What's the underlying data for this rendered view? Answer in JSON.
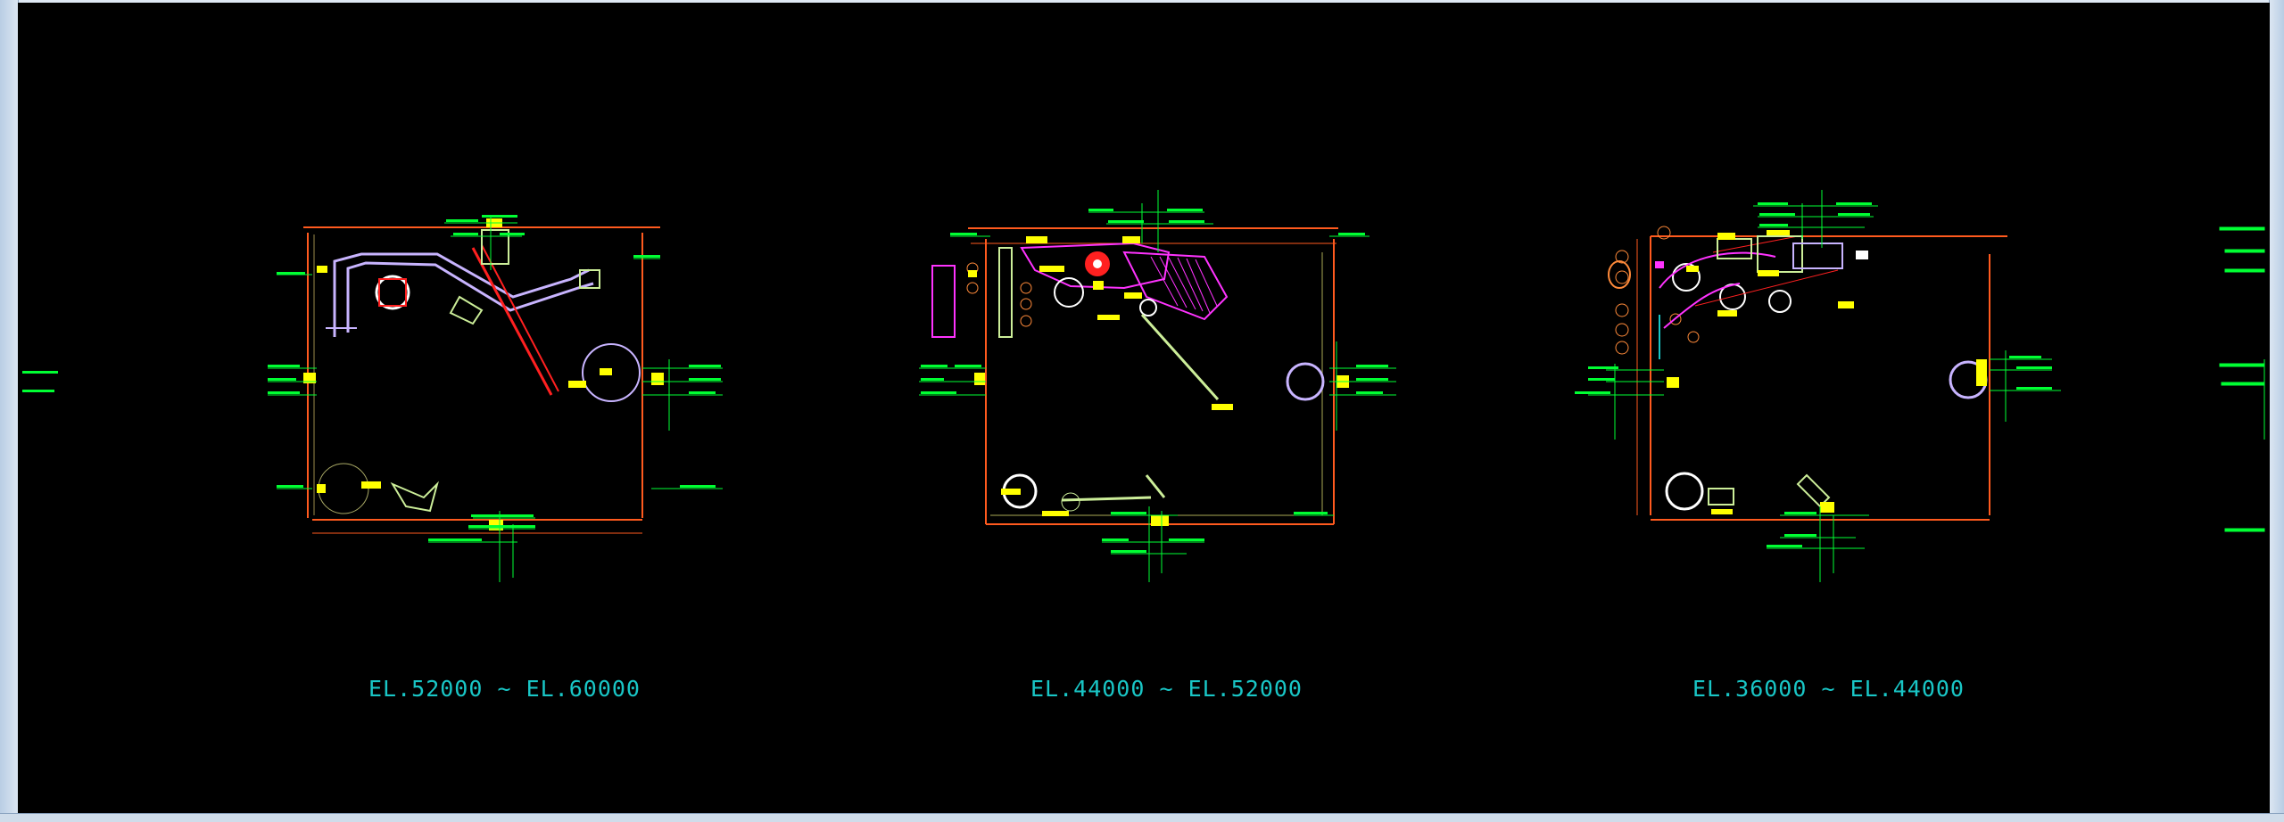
{
  "drawing": {
    "background_color": "#000000",
    "colors": {
      "wall": "#ff5a1e",
      "dimension": "#00ff33",
      "tag": "#ffff00",
      "pipe": "#c8b4ff",
      "magenta": "#ff33ff",
      "red": "#ff2020",
      "cyan_text": "#19c6c6"
    },
    "labels": [
      {
        "id": "elev-1",
        "text": "EL.52000 ~ EL.60000"
      },
      {
        "id": "elev-2",
        "text": "EL.44000 ~ EL.52000"
      },
      {
        "id": "elev-3",
        "text": "EL.36000 ~ EL.44000"
      }
    ]
  }
}
